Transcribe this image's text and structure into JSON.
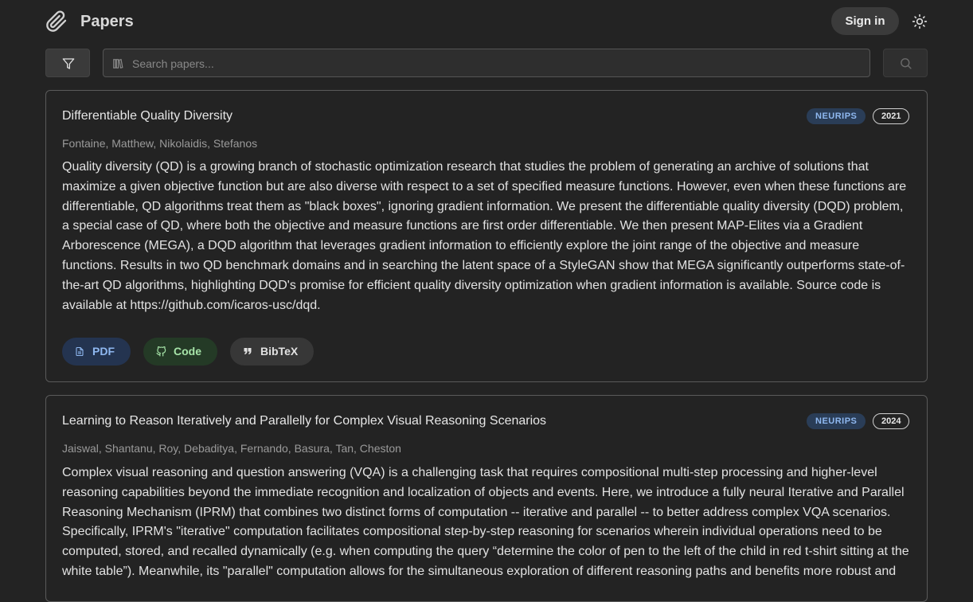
{
  "app": {
    "brand": "Papers",
    "sign_in": "Sign in"
  },
  "search": {
    "placeholder": "Search papers...",
    "value": ""
  },
  "papers": [
    {
      "title": "Differentiable Quality Diversity",
      "venue": "NEURIPS",
      "year": "2021",
      "authors": "Fontaine, Matthew, Nikolaidis, Stefanos",
      "abstract": "Quality diversity (QD) is a growing branch of stochastic optimization research that studies the problem of generating an archive of solutions that maximize a given objective function but are also diverse with respect to a set of specified measure functions. However, even when these functions are differentiable, QD algorithms treat them as \"black boxes\", ignoring gradient information. We present the differentiable quality diversity (DQD) problem, a special case of QD, where both the objective and measure functions are first order differentiable. We then present MAP-Elites via a Gradient Arborescence (MEGA), a DQD algorithm that leverages gradient information to efficiently explore the joint range of the objective and measure functions. Results in two QD benchmark domains and in searching the latent space of a StyleGAN show that MEGA significantly outperforms state-of-the-art QD algorithms, highlighting DQD's promise for efficient quality diversity optimization when gradient information is available. Source code is available at https://github.com/icaros-usc/dqd.",
      "buttons": {
        "pdf": "PDF",
        "code": "Code",
        "bibtex": "BibTeX"
      }
    },
    {
      "title": "Learning to Reason Iteratively and Parallelly for Complex Visual Reasoning Scenarios",
      "venue": "NEURIPS",
      "year": "2024",
      "authors": "Jaiswal, Shantanu, Roy, Debaditya, Fernando, Basura, Tan, Cheston",
      "abstract": "Complex visual reasoning and question answering (VQA) is a challenging task that requires compositional multi-step processing and higher-level reasoning capabilities beyond the immediate recognition and localization of objects and events. Here, we introduce a fully neural Iterative and Parallel Reasoning Mechanism (IPRM) that combines two distinct forms of computation -- iterative and parallel -- to better address complex VQA scenarios. Specifically, IPRM's \"iterative\" computation facilitates compositional step-by-step reasoning for scenarios wherein individual operations need to be computed, stored, and recalled dynamically (e.g. when computing the query “determine the color of pen to the left of the child in red t-shirt sitting at the white table”). Meanwhile, its \"parallel\" computation allows for the simultaneous exploration of different reasoning paths and benefits more robust and"
    }
  ]
}
